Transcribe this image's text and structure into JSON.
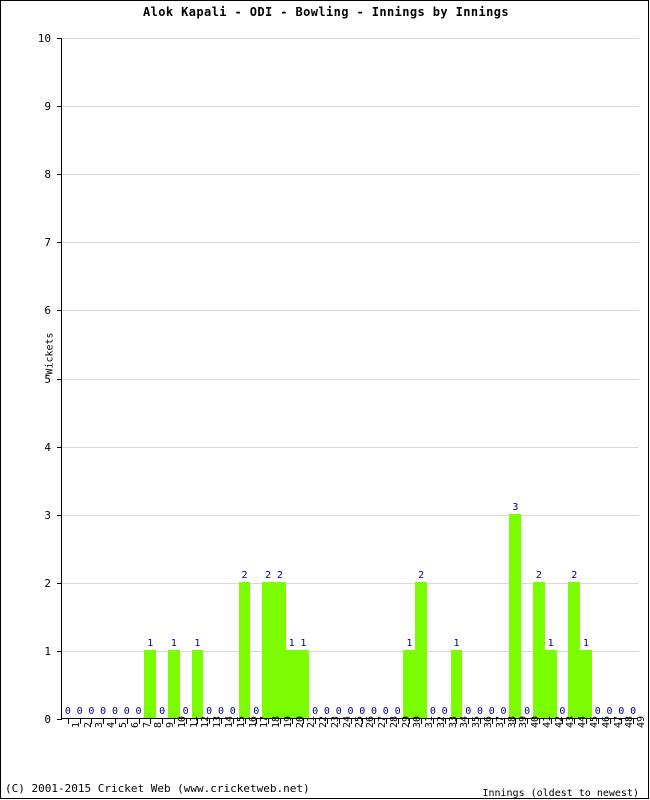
{
  "chart": {
    "title": "Alok Kapali - ODI - Bowling - Innings by Innings",
    "footer": "(C) 2001-2015 Cricket Web (www.cricketweb.net)",
    "bar_color": "#7CFC00",
    "label_color": "#000080",
    "grid_color": "#D9D9D9",
    "axis_color": "#000000"
  },
  "chart_data": {
    "type": "bar",
    "title": "Alok Kapali - ODI - Bowling - Innings by Innings",
    "xlabel": "Innings (oldest to newest)",
    "ylabel": "Wickets",
    "xlim": [
      1,
      49
    ],
    "ylim": [
      0,
      10
    ],
    "ytick_labels": [
      "0",
      "1",
      "2",
      "3",
      "4",
      "5",
      "6",
      "7",
      "8",
      "9",
      "10"
    ],
    "ytick_values": [
      0,
      1,
      2,
      3,
      4,
      5,
      6,
      7,
      8,
      9,
      10
    ],
    "grid": true,
    "legend": false,
    "show_value_labels": true,
    "categories": [
      "1",
      "2",
      "3",
      "4",
      "5",
      "6",
      "7",
      "8",
      "9",
      "10",
      "11",
      "12",
      "13",
      "14",
      "15",
      "16",
      "17",
      "18",
      "19",
      "20",
      "21",
      "22",
      "23",
      "24",
      "25",
      "26",
      "27",
      "28",
      "29",
      "30",
      "31",
      "32",
      "33",
      "34",
      "35",
      "36",
      "37",
      "38",
      "39",
      "40",
      "41",
      "42",
      "43",
      "44",
      "45",
      "46",
      "47",
      "48",
      "49"
    ],
    "values": [
      0,
      0,
      0,
      0,
      0,
      0,
      0,
      1,
      0,
      1,
      0,
      1,
      0,
      0,
      0,
      2,
      0,
      2,
      2,
      1,
      1,
      0,
      0,
      0,
      0,
      0,
      0,
      0,
      0,
      1,
      2,
      0,
      0,
      1,
      0,
      0,
      0,
      0,
      3,
      0,
      2,
      1,
      0,
      2,
      1,
      0,
      0,
      0,
      0
    ]
  }
}
